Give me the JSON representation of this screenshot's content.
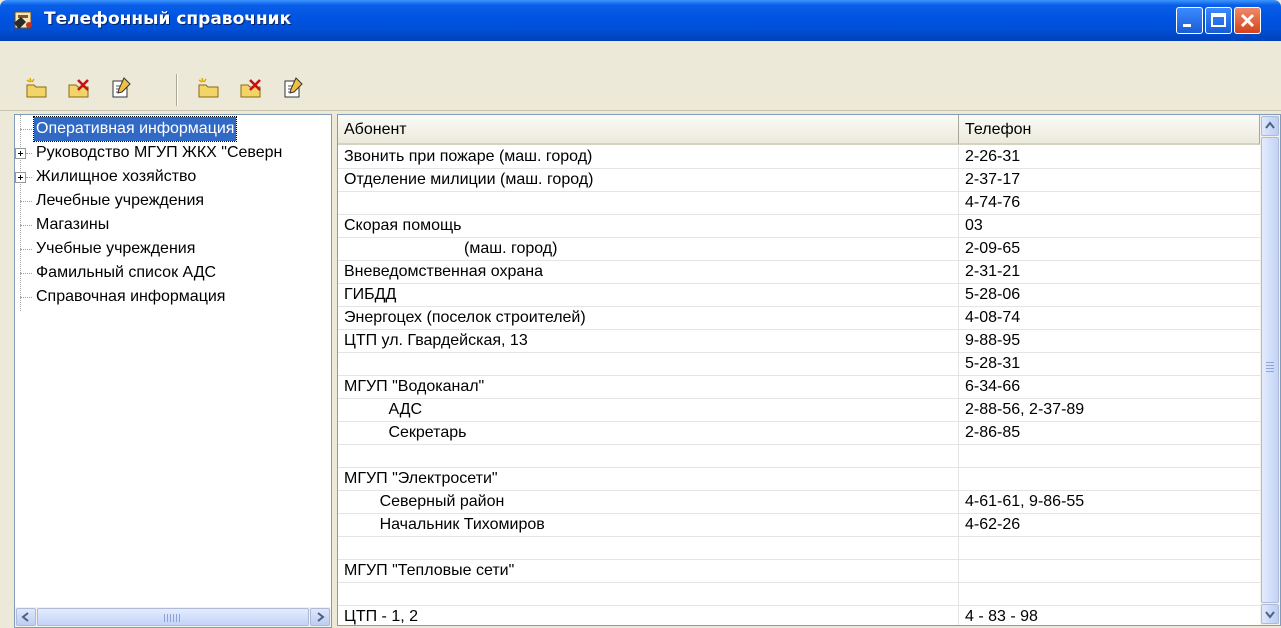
{
  "window": {
    "title": "Телефонный справочник"
  },
  "toolbar": {
    "buttons": [
      {
        "icon": "folder-new-icon"
      },
      {
        "icon": "folder-delete-icon"
      },
      {
        "icon": "edit-document-icon"
      },
      {
        "icon": "folder-new-icon"
      },
      {
        "icon": "folder-delete-icon"
      },
      {
        "icon": "edit-document-icon"
      }
    ]
  },
  "tree": {
    "items": [
      {
        "label": "Оперативная информация",
        "selected": true,
        "expandable": false
      },
      {
        "label": "Руководство МГУП ЖКХ \"Северн",
        "selected": false,
        "expandable": true
      },
      {
        "label": "Жилищное хозяйство",
        "selected": false,
        "expandable": true
      },
      {
        "label": "Лечебные учреждения",
        "selected": false,
        "expandable": false
      },
      {
        "label": "Магазины",
        "selected": false,
        "expandable": false
      },
      {
        "label": "Учебные учреждения",
        "selected": false,
        "expandable": false
      },
      {
        "label": "Фамильный список АДС",
        "selected": false,
        "expandable": false
      },
      {
        "label": "Справочная информация",
        "selected": false,
        "expandable": false
      }
    ]
  },
  "grid": {
    "columns": {
      "abonent": "Абонент",
      "phone": "Телефон"
    },
    "rows": [
      {
        "abonent": "Звонить при пожаре (маш. город)",
        "phone": "2-26-31"
      },
      {
        "abonent": "Отделение милиции (маш. город)",
        "phone": "2-37-17"
      },
      {
        "abonent": "",
        "phone": "4-74-76"
      },
      {
        "abonent": "Скорая помощь",
        "phone": "03"
      },
      {
        "abonent": "                           (маш. город)",
        "phone": "2-09-65"
      },
      {
        "abonent": "Вневедомственная охрана",
        "phone": "2-31-21"
      },
      {
        "abonent": "ГИБДД",
        "phone": "5-28-06"
      },
      {
        "abonent": "Энергоцех (поселок строителей)",
        "phone": "4-08-74"
      },
      {
        "abonent": "ЦТП ул. Гвардейская, 13",
        "phone": "9-88-95"
      },
      {
        "abonent": "",
        "phone": "5-28-31"
      },
      {
        "abonent": "МГУП \"Водоканал\"",
        "phone": "6-34-66"
      },
      {
        "abonent": "          АДС",
        "phone": "2-88-56, 2-37-89"
      },
      {
        "abonent": "          Секретарь",
        "phone": "2-86-85"
      },
      {
        "abonent": "",
        "phone": ""
      },
      {
        "abonent": "МГУП \"Электросети\"",
        "phone": ""
      },
      {
        "abonent": "        Северный район",
        "phone": "4-61-61, 9-86-55"
      },
      {
        "abonent": "        Начальник Тихомиров",
        "phone": "4-62-26"
      },
      {
        "abonent": "",
        "phone": ""
      },
      {
        "abonent": "МГУП \"Тепловые сети\"",
        "phone": ""
      },
      {
        "abonent": "",
        "phone": ""
      },
      {
        "abonent": "ЦТП - 1, 2",
        "phone": "4 - 83 - 98"
      }
    ]
  },
  "colors": {
    "titlebar": "#0054e3",
    "selection": "#316ac5",
    "close_button": "#d4431a"
  }
}
